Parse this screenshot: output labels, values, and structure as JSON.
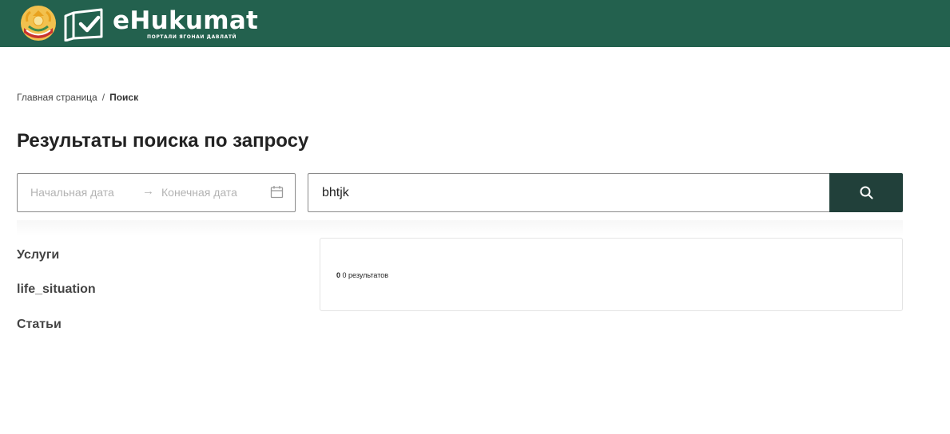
{
  "header": {
    "brand": "eHukumat",
    "subtitle": "ПОРТАЛИ ЯГОНАИ ДАВЛАТӢ"
  },
  "breadcrumb": {
    "home": "Главная страница",
    "separator": "/",
    "current": "Поиск"
  },
  "page": {
    "title": "Результаты поиска по запросу"
  },
  "date_filter": {
    "start_placeholder": "Начальная дата",
    "end_placeholder": "Конечная дата",
    "arrow": "→"
  },
  "search": {
    "value": "bhtjk"
  },
  "sidebar": {
    "items": [
      {
        "label": "Услуги"
      },
      {
        "label": "life_situation"
      },
      {
        "label": "Статьи"
      }
    ]
  },
  "results": {
    "count": "0",
    "text": "0 результатов"
  },
  "colors": {
    "header_bg": "#23614e",
    "search_button": "#21403a"
  },
  "icons": [
    "emblem-icon",
    "logo-icon",
    "calendar-icon",
    "search-icon"
  ]
}
